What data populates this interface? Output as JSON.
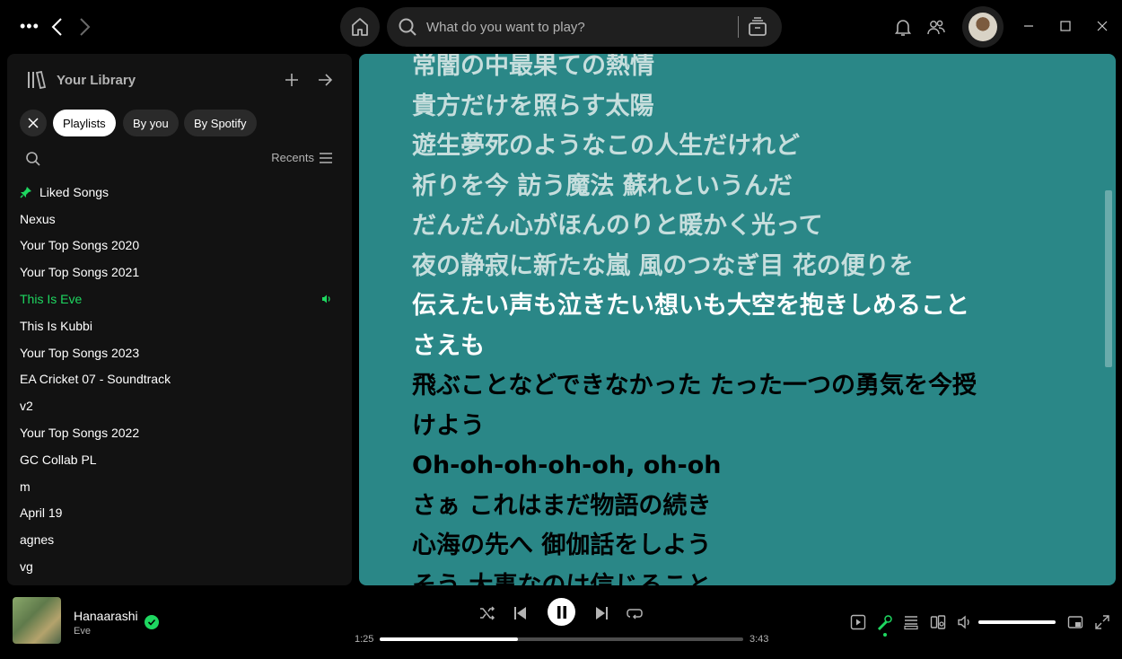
{
  "topbar": {
    "search_placeholder": "What do you want to play?"
  },
  "library": {
    "title": "Your Library",
    "filters": [
      "Playlists",
      "By you",
      "By Spotify"
    ],
    "sort_label": "Recents",
    "items": [
      {
        "label": "Liked Songs",
        "pinned": true
      },
      {
        "label": "Nexus"
      },
      {
        "label": "Your Top Songs 2020"
      },
      {
        "label": "Your Top Songs 2021"
      },
      {
        "label": "This Is Eve",
        "playing": true
      },
      {
        "label": "This Is Kubbi"
      },
      {
        "label": "Your Top Songs 2023"
      },
      {
        "label": "EA Cricket 07 - Soundtrack"
      },
      {
        "label": "v2"
      },
      {
        "label": "Your Top Songs 2022"
      },
      {
        "label": "GC Collab PL"
      },
      {
        "label": "m"
      },
      {
        "label": "April 19"
      },
      {
        "label": "agnes"
      },
      {
        "label": "vg"
      }
    ]
  },
  "lyrics": {
    "lines": [
      {
        "text": "常闇の中最果ての熱情",
        "state": "past"
      },
      {
        "text": "貴方だけを照らす太陽",
        "state": "past"
      },
      {
        "text": "遊生夢死のようなこの人生だけれど",
        "state": "past"
      },
      {
        "text": "祈りを今 訪う魔法 蘇れというんだ",
        "state": "past"
      },
      {
        "text": "だんだん心がほんのりと暖かく光って",
        "state": "past"
      },
      {
        "text": "夜の静寂に新たな嵐 風のつなぎ目 花の便りを",
        "state": "past"
      },
      {
        "text": "伝えたい声も泣きたい想いも大空を抱きしめること",
        "state": "active"
      },
      {
        "text": "さえも",
        "state": "active"
      },
      {
        "text": "飛ぶことなどできなかった たった一つの勇気を今授",
        "state": "upcoming"
      },
      {
        "text": "けよう",
        "state": "upcoming"
      },
      {
        "text": "Oh-oh-oh-oh-oh, oh-oh",
        "state": "upcoming"
      },
      {
        "text": "さぁ これはまだ物語の続き",
        "state": "upcoming"
      },
      {
        "text": "心海の先へ 御伽話をしよう",
        "state": "upcoming"
      },
      {
        "text": "そう 大事なのは信じること",
        "state": "upcoming"
      }
    ]
  },
  "player": {
    "title": "Hanaarashi",
    "artist": "Eve",
    "time_current": "1:25",
    "time_total": "3:43",
    "progress_fraction": 0.38,
    "volume_fraction": 1.0,
    "accent": "#1ed760"
  }
}
